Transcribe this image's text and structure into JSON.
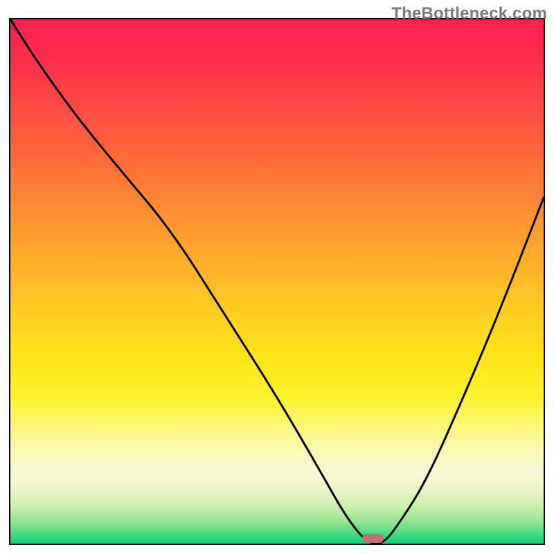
{
  "watermark": "TheBottleneck.com",
  "chart_data": {
    "type": "line",
    "title": "",
    "xlabel": "",
    "ylabel": "",
    "xlim": [
      0,
      100
    ],
    "ylim": [
      0,
      100
    ],
    "grid": false,
    "legend": false,
    "annotations": [],
    "background": {
      "type": "vertical-gradient",
      "stops": [
        {
          "pos": 0.0,
          "color": "#ff1f52"
        },
        {
          "pos": 0.22,
          "color": "#ff5a3e"
        },
        {
          "pos": 0.48,
          "color": "#ffb329"
        },
        {
          "pos": 0.72,
          "color": "#fff22c"
        },
        {
          "pos": 0.9,
          "color": "#e9f6c5"
        },
        {
          "pos": 1.0,
          "color": "#13cf70"
        }
      ]
    },
    "series": [
      {
        "name": "bottleneck-curve",
        "x": [
          0,
          5,
          12,
          20,
          30,
          40,
          50,
          58,
          63,
          67,
          70,
          73,
          78,
          85,
          92,
          100
        ],
        "values": [
          100,
          92,
          82,
          72,
          60,
          44,
          28,
          14,
          5,
          0,
          0,
          4,
          12,
          28,
          45,
          66
        ],
        "color": "#000000",
        "stroke_width": 3
      }
    ],
    "marker": {
      "shape": "pill",
      "color": "#c87070",
      "x_range": [
        66,
        70
      ],
      "y": 0
    }
  }
}
